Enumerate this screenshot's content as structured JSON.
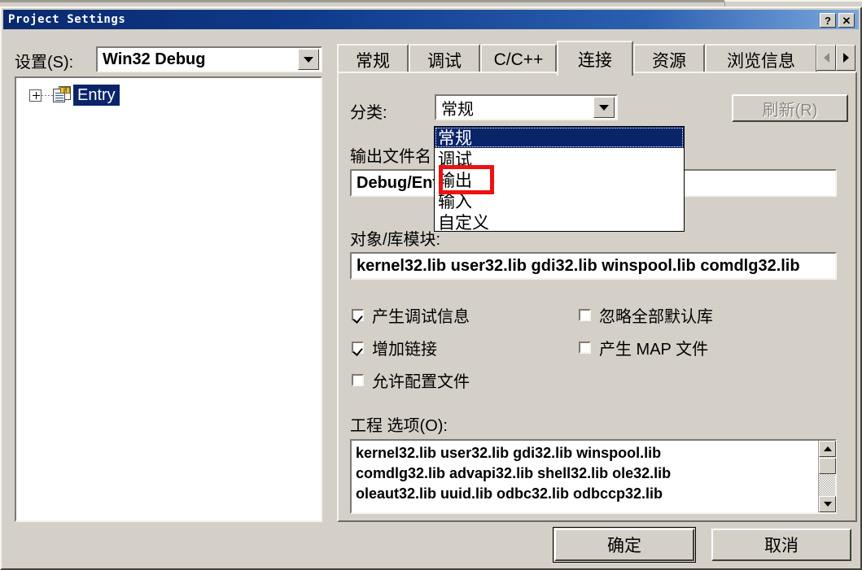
{
  "window": {
    "title": "Project Settings",
    "help_button": "?",
    "close_button": "✕"
  },
  "left_pane": {
    "settings_label": "设置(S):",
    "settings_combo_value": "Win32 Debug",
    "tree": {
      "expander": "+",
      "node_label": "Entry",
      "icon": "project-document-icon"
    }
  },
  "tabs": {
    "items": [
      {
        "label": "常规",
        "selected": false
      },
      {
        "label": "调试",
        "selected": false
      },
      {
        "label": "C/C++",
        "selected": false
      },
      {
        "label": "连接",
        "selected": true
      },
      {
        "label": "资源",
        "selected": false
      },
      {
        "label": "浏览信息",
        "selected": false
      }
    ],
    "scroll_left": "scroll-left-icon",
    "scroll_right": "scroll-right-icon"
  },
  "panel": {
    "category_label": "分类:",
    "category_value": "常规",
    "reset_button": "刷新(R)",
    "reset_button_disabled": true,
    "category_options": [
      {
        "label": "常规",
        "highlighted": true
      },
      {
        "label": "调试",
        "highlighted": false
      },
      {
        "label": "输出",
        "highlighted": false
      },
      {
        "label": "输入",
        "highlighted": false
      },
      {
        "label": "自定义",
        "highlighted": false
      }
    ],
    "output_filename_label": "输出文件名",
    "output_filename_value": "Debug/Ent",
    "object_modules_label": "对象/库模块:",
    "object_modules_value": "kernel32.lib user32.lib gdi32.lib winspool.lib comdlg32.lib",
    "checkboxes": [
      {
        "label": "产生调试信息",
        "checked": true
      },
      {
        "label": "增加链接",
        "checked": true
      },
      {
        "label": "允许配置文件",
        "checked": false
      },
      {
        "label": "忽略全部默认库",
        "checked": false
      },
      {
        "label": "产生 MAP 文件",
        "checked": false
      }
    ],
    "project_options_label": "工程 选项(O):",
    "project_options_lines": [
      "kernel32.lib user32.lib gdi32.lib winspool.lib",
      "comdlg32.lib advapi32.lib shell32.lib ole32.lib",
      "oleaut32.lib uuid.lib odbc32.lib odbccp32.lib"
    ]
  },
  "footer": {
    "ok_button": "确定",
    "cancel_button": "取消"
  },
  "annotation": {
    "type": "red-rectangle-highlight",
    "target": "输出",
    "color": "#ee1111"
  },
  "colors": {
    "dialog_face": "#d4d0c8",
    "titlebar_start": "#0a2a6e",
    "titlebar_end": "#7ba7dd",
    "selection": "#0a246a",
    "disabled_text": "#8a8781",
    "annotation_red": "#ee1111"
  }
}
